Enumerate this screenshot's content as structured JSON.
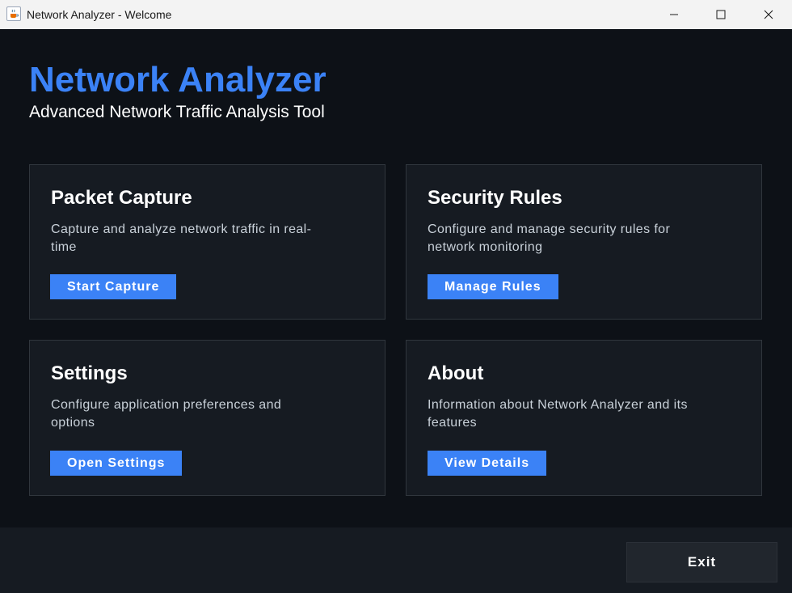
{
  "window": {
    "title": "Network Analyzer - Welcome",
    "app_icon": "java-cup-icon",
    "controls": [
      "minimize-icon",
      "maximize-icon",
      "close-icon"
    ]
  },
  "header": {
    "title": "Network Analyzer",
    "subtitle": "Advanced Network Traffic Analysis Tool"
  },
  "cards": [
    {
      "title": "Packet Capture",
      "description": "Capture and analyze network traffic in real-time",
      "button_label": "Start Capture"
    },
    {
      "title": "Security Rules",
      "description": "Configure and manage security rules for network monitoring",
      "button_label": "Manage Rules"
    },
    {
      "title": "Settings",
      "description": "Configure application preferences and options",
      "button_label": "Open Settings"
    },
    {
      "title": "About",
      "description": "Information about Network Analyzer and its features",
      "button_label": "View Details"
    }
  ],
  "footer": {
    "exit_label": "Exit"
  },
  "colors": {
    "accent": "#3b82f6",
    "background": "#0d1117",
    "card": "#161b22",
    "card_border": "#30363d",
    "exit_button": "#21262d"
  }
}
